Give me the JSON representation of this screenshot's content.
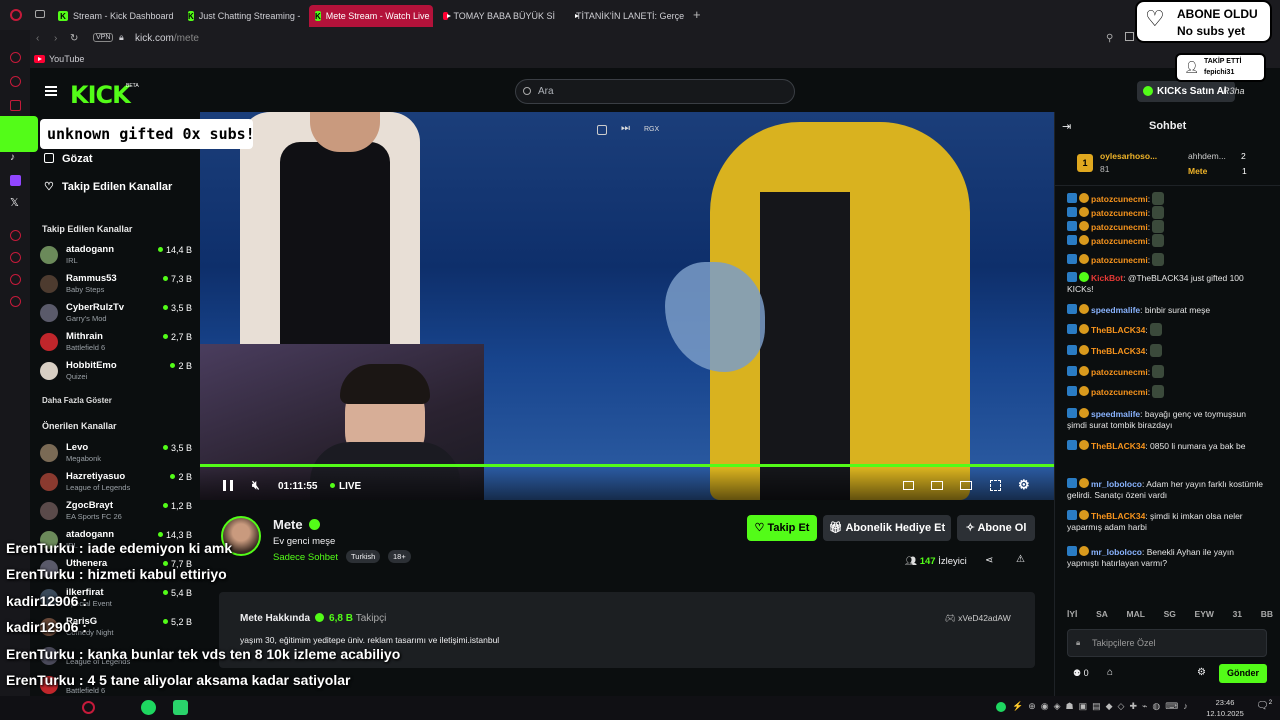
{
  "tabs": [
    {
      "label": "Stream - Kick Dashboard",
      "type": "kick"
    },
    {
      "label": "Just Chatting Streaming -",
      "type": "kick"
    },
    {
      "label": "Mete Stream - Watch Live",
      "type": "kick",
      "active": true
    },
    {
      "label": "TOMAY BABA BÜYÜK Sİ",
      "type": "youtube"
    },
    {
      "label": "TİTANİK'İN LANETİ: Gerçe",
      "type": "youtube"
    }
  ],
  "address": {
    "vpn": "VPN",
    "url_host": "kick.com",
    "url_path": "/mete"
  },
  "bookmarks": {
    "youtube": "YouTube"
  },
  "header": {
    "logo": "KICK",
    "logo_beta": "BETA",
    "search_placeholder": "Ara",
    "kicks_button": "KICKs Satın Al",
    "user": "R3ha"
  },
  "sidebar": {
    "browse": "Gözat",
    "following_nav": "Takip Edilen Kanallar",
    "following_header": "Takip Edilen Kanallar",
    "following": [
      {
        "name": "atadogann",
        "category": "IRL",
        "viewers": "14,4 B",
        "color": "#6b8a5a"
      },
      {
        "name": "Rammus53",
        "category": "Baby Steps",
        "viewers": "7,3 B",
        "color": "#4d3b2f"
      },
      {
        "name": "CyberRulzTv",
        "category": "Garry's Mod",
        "viewers": "3,5 B",
        "color": "#5a5a6a"
      },
      {
        "name": "Mithrain",
        "category": "Battlefield 6",
        "viewers": "2,7 B",
        "color": "#c0262b"
      },
      {
        "name": "HobbitEmo",
        "category": "Quizei",
        "viewers": "2 B",
        "color": "#d8cfc4"
      }
    ],
    "show_more": "Daha Fazla Göster",
    "recommended_header": "Önerilen Kanallar",
    "recommended": [
      {
        "name": "Levo",
        "category": "Megabonk",
        "viewers": "3,5 B",
        "color": "#7a6a55"
      },
      {
        "name": "Hazretiyasuo",
        "category": "League of Legends",
        "viewers": "2 B",
        "color": "#8a3a2f"
      },
      {
        "name": "ZgocBrayt",
        "category": "EA Sports FC 26",
        "viewers": "1,2 B",
        "color": "#5a4a4a"
      },
      {
        "name": "atadogann",
        "category": "IRL",
        "viewers": "14,3 B",
        "color": "#6b8a5a"
      },
      {
        "name": "Uthenera",
        "category": "",
        "viewers": "7,7 B",
        "color": "#5a5a6a"
      },
      {
        "name": "ilkerfirat",
        "category": "Special Event",
        "viewers": "5,4 B",
        "color": "#3a4a5a"
      },
      {
        "name": "RarisG",
        "category": "Comedy Night",
        "viewers": "5,2 B",
        "color": "#6a4a3a"
      },
      {
        "name": "",
        "category": "League of Legends",
        "viewers": "",
        "color": "#4a4a5a"
      },
      {
        "name": "",
        "category": "Battlefield 6",
        "viewers": "",
        "color": "#c0262b"
      }
    ]
  },
  "video": {
    "pip_label": "RGX",
    "time": "01:11:55",
    "live": "LIVE",
    "progress_fraction": 1.0
  },
  "channel": {
    "name": "Mete",
    "title": "Ev genci meşe",
    "category": "Sadece Sohbet",
    "tags": [
      "Turkish",
      "18+"
    ],
    "follow": "Takip Et",
    "gift_sub": "Abonelik Hediye Et",
    "subscribe": "Abone Ol",
    "viewers": "147",
    "viewers_label": "İzleyici",
    "about_title": "Mete Hakkında",
    "followers": "6,8 B",
    "followers_label": "Takipçi",
    "bio": "yaşım 30, eğitimim yeditepe üniv. reklam tasarımı ve iletişimi.istanbul",
    "discord": "xVeD42adAW"
  },
  "chat": {
    "title": "Sohbet",
    "leaderboard": [
      {
        "rank": "1",
        "name": "oylesarhoso...",
        "value": "81"
      },
      {
        "name": "ahhdem...",
        "value": "2"
      },
      {
        "name": "Mete",
        "value": "1"
      }
    ],
    "messages": [
      {
        "user": "patozcunecmi",
        "text": "",
        "color": "#f7941d",
        "emote": true
      },
      {
        "user": "patozcunecmi",
        "text": "",
        "color": "#f7941d",
        "emote": true
      },
      {
        "user": "patozcunecmi",
        "text": "",
        "color": "#f7941d",
        "emote": true
      },
      {
        "user": "patozcunecmi",
        "text": "",
        "color": "#f7941d",
        "emote": true
      },
      {
        "user": "patozcunecmi",
        "text": "",
        "color": "#f7941d",
        "emote": true
      },
      {
        "user": "KickBot",
        "text": "@TheBLACK34 just gifted 100 KICKs!",
        "color": "#e53935"
      },
      {
        "user": "speedmalife",
        "text": "binbir surat meşe",
        "color": "#8ab4ff"
      },
      {
        "user": "TheBLACK34",
        "text": "",
        "color": "#f7941d",
        "emote": true
      },
      {
        "user": "TheBLACK34",
        "text": "",
        "color": "#f7941d",
        "emote": true
      },
      {
        "user": "patozcunecmi",
        "text": "",
        "color": "#f7941d",
        "emote": true
      },
      {
        "user": "patozcunecmi",
        "text": "",
        "color": "#f7941d",
        "emote": true
      },
      {
        "user": "speedmalife",
        "text": "bayağı genç ve toymuşsun şimdi surat tombik birazdayı",
        "color": "#8ab4ff"
      },
      {
        "user": "TheBLACK34",
        "text": "0850 li numara ya bak be",
        "color": "#f7941d"
      },
      {
        "user": "mr_loboloco",
        "text": "Adam her yayın farklı kostümle gelirdi. Sanatçı özeni vardı",
        "color": "#8ab4ff"
      },
      {
        "user": "TheBLACK34",
        "text": "şimdi ki imkan olsa neler yaparmış adam harbi",
        "color": "#f7941d"
      },
      {
        "user": "mr_loboloco",
        "text": "Benekli Ayhan ile yayın yapmıştı hatırlayan varmı?",
        "color": "#8ab4ff"
      }
    ],
    "emote_bar": [
      "İYİ",
      "SA",
      "MAL",
      "SG",
      "EYW",
      "31",
      "BB"
    ],
    "input_placeholder": "Takipçilere Özel",
    "points": "0",
    "send": "Gönder"
  },
  "overlay": {
    "sub_goal_title": "ABONE OLDU",
    "sub_goal_sub": "No subs yet",
    "follow_title": "TAKİP ETTİ",
    "follow_user": "fepichi31",
    "gift_banner": "unknown gifted 0x subs!",
    "chat_lines": [
      {
        "user": "ErenTurku",
        "text": "iade edemiyon ki amk"
      },
      {
        "user": "ErenTurku",
        "text": "hizmeti kabul ettiriyo"
      },
      {
        "user": "kadir12906",
        "text": ""
      },
      {
        "user": "kadir12906",
        "text": ""
      },
      {
        "user": "ErenTurku",
        "text": "kanka bunlar tek vds ten 8 10k izleme acabiliyo"
      },
      {
        "user": "ErenTurku",
        "text": "4 5 tane aliyolar aksama kadar satiyolar"
      },
      {
        "user": "kadir12906",
        "text": ""
      }
    ]
  },
  "taskbar": {
    "time": "23:46",
    "date": "12.10.2025",
    "notif": "2"
  }
}
